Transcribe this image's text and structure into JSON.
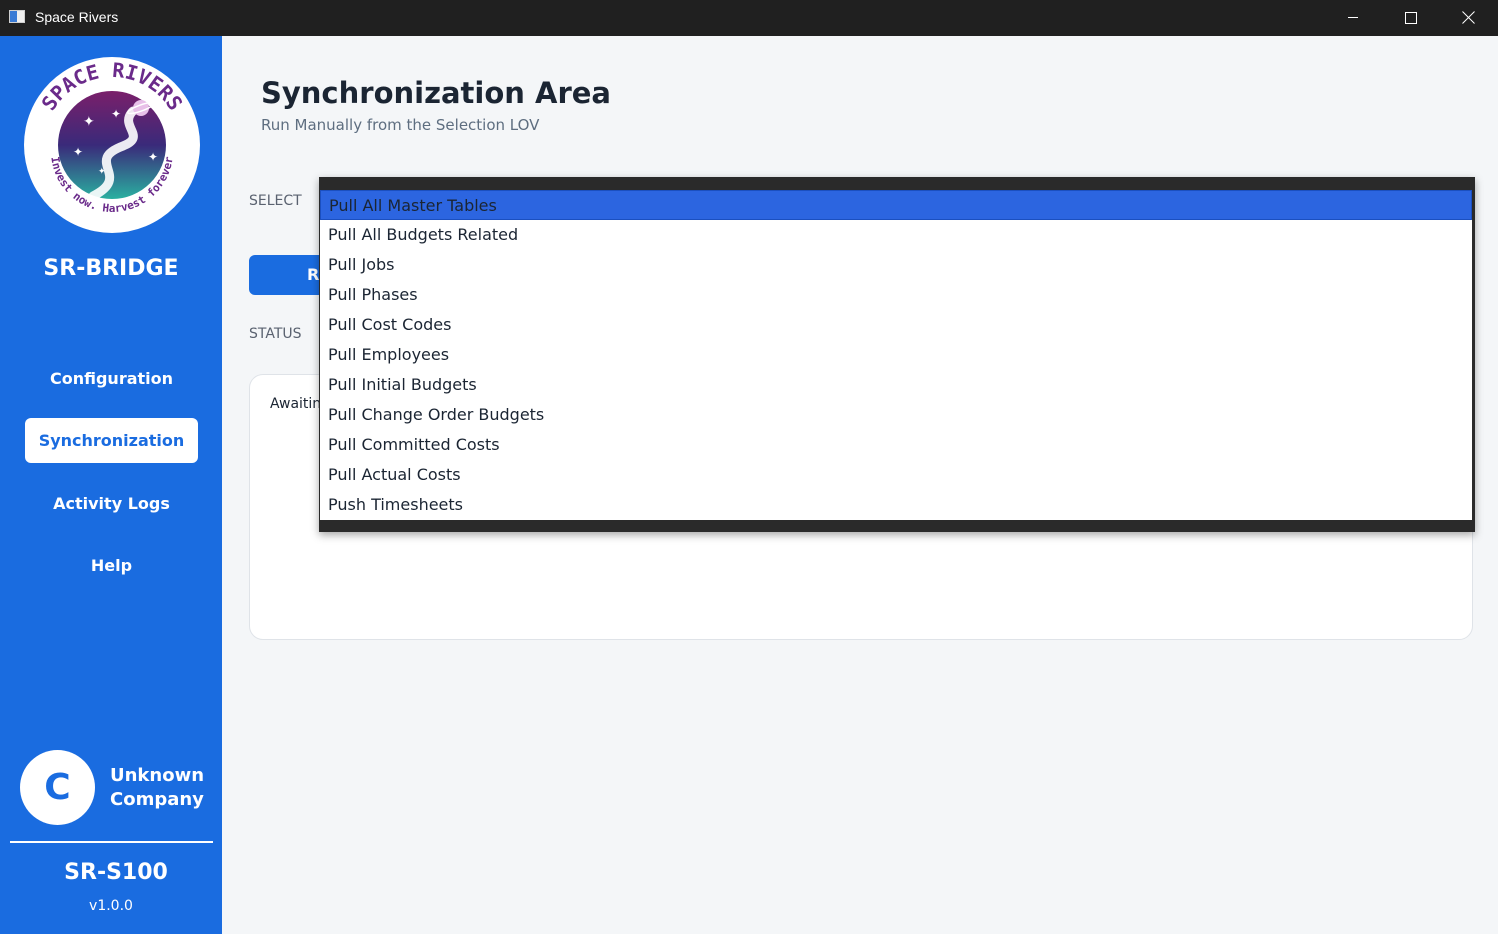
{
  "window": {
    "title": "Space Rivers"
  },
  "sidebar": {
    "logo": {
      "top_text": "SPACE RIVERS",
      "bottom_text": "Invest now. Harvest forever"
    },
    "brand": "SR-BRIDGE",
    "nav": [
      {
        "label": "Configuration",
        "active": false
      },
      {
        "label": "Synchronization",
        "active": true
      },
      {
        "label": "Activity Logs",
        "active": false
      },
      {
        "label": "Help",
        "active": false
      }
    ],
    "company": {
      "initial": "C",
      "name_line1": "Unknown",
      "name_line2": "Company"
    },
    "product": "SR-S100",
    "version": "v1.0.0"
  },
  "main": {
    "title": "Synchronization Area",
    "subtitle": "Run Manually from the Selection LOV",
    "select_label": "SELECT",
    "run_button_label": "R",
    "status_label": "STATUS",
    "status_text": "Awaitin"
  },
  "dropdown": {
    "selected": "Pull All Master Tables",
    "options": [
      "Pull All Master Tables",
      "Pull All Budgets Related",
      "Pull Jobs",
      "Pull Phases",
      "Pull Cost Codes",
      "Pull Employees",
      "Pull Initial Budgets",
      "Pull Change Order Budgets",
      "Pull Committed Costs",
      "Pull Actual Costs",
      "Push Timesheets"
    ]
  },
  "colors": {
    "sidebar_bg": "#1a6ce0",
    "titlebar_bg": "#202020",
    "highlight": "#2c65e0",
    "content_bg": "#f4f6f8"
  }
}
